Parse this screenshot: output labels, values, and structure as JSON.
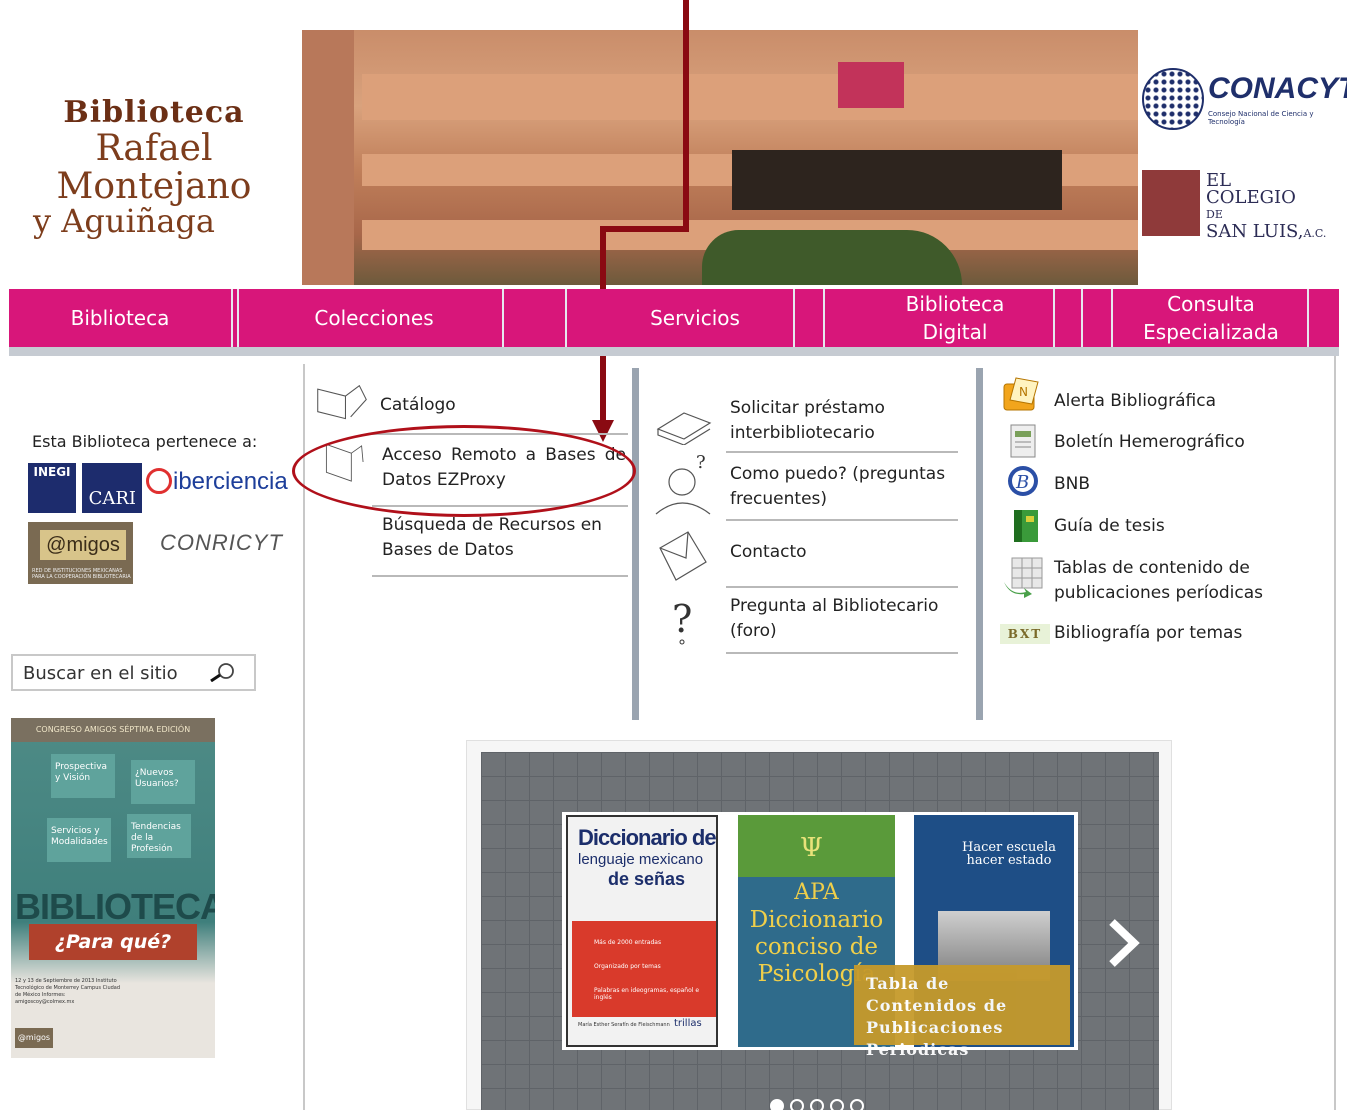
{
  "header": {
    "library_name_line1": "Biblioteca",
    "library_name_line2": "Rafael Montejano",
    "library_name_line3": "y Aguiñaga",
    "conacyt": {
      "name": "CONACYT",
      "subtitle": "Consejo Nacional de Ciencia y Tecnología"
    },
    "colegio": {
      "line1": "EL",
      "line2": "COLEGIO",
      "line3": "DE",
      "line4": "SAN LUIS,",
      "suffix": "A.C."
    },
    "banner_sign": "BIBLIOTECA"
  },
  "nav": {
    "items": [
      {
        "label": "Biblioteca"
      },
      {
        "label": "Colecciones"
      },
      {
        "label": "Servicios"
      },
      {
        "label": "Biblioteca Digital"
      },
      {
        "label": "Consulta Especializada"
      }
    ]
  },
  "sidebar": {
    "pertenece": "Esta Biblioteca pertenece a:",
    "logos": {
      "inegi": "INEGI",
      "cari": "CARI",
      "ciberciencia": "iberciencia",
      "amigos": "@migos",
      "amigos_sub": "RED DE INSTITUCIONES MEXICANAS PARA LA COOPERACIÓN BIBLIOTECARIA",
      "conricyt": "CONRICYT"
    },
    "search_label": "Buscar en el sitio",
    "poster": {
      "top": "CONGRESO AMIGOS   SÉPTIMA EDICIÓN",
      "sign1": "Prospectiva y Visión",
      "sign2": "¿Nuevos Usuarios?",
      "sign3": "Servicios y Modalidades",
      "sign4": "Tendencias de la Profesión",
      "title": "BIBLIOTECAS",
      "subtitle": "¿Para qué?",
      "footer": "12 y 13 de Septiembre de 2013 Instituto Tecnológico de Monterrey Campus Ciudad de México Informes: amigoscoy@colmex.mx",
      "footer_logo": "@migos"
    }
  },
  "colecciones": {
    "items": [
      {
        "label": "Catálogo"
      },
      {
        "label": "Acceso Remoto a Bases de Datos EZProxy"
      },
      {
        "label": "Búsqueda de Recursos en Bases de Datos"
      }
    ]
  },
  "servicios": {
    "items": [
      {
        "label": "Solicitar préstamo interbibliotecario"
      },
      {
        "label": "Como puedo? (preguntas frecuentes)"
      },
      {
        "label": "Contacto"
      },
      {
        "label": "Pregunta al Bibliotecario (foro)"
      }
    ]
  },
  "digital": {
    "items": [
      {
        "label": "Alerta Bibliográfica",
        "icon": "alert-icon"
      },
      {
        "label": "Boletín Hemerográfico",
        "icon": "newsletter-icon"
      },
      {
        "label": "BNB",
        "icon": "bnb-icon"
      },
      {
        "label": "Guía de tesis",
        "icon": "thesis-icon"
      },
      {
        "label": "Tablas de contenido de publicaciones períodicas",
        "icon": "table-icon"
      },
      {
        "label": "Bibliografía por temas",
        "icon": "bxt-icon",
        "badge": "BXT"
      }
    ]
  },
  "carousel": {
    "book1": {
      "title_a": "Diccionario de",
      "title_b": "lenguaje mexicano",
      "title_c": "de señas",
      "bullets": [
        "Más de 2000 entradas",
        "Organizado por temas",
        "Palabras en ideogramas, español e inglés"
      ],
      "author": "María Esther Serafín de Fleischmann",
      "publisher": "trillas"
    },
    "book2": {
      "psi": "Ψ",
      "apa": "APA",
      "title": "Diccionario conciso de Psicología"
    },
    "book3": {
      "title": "Hacer escuela hacer estado"
    },
    "caption": "Tabla de Contenidos de Publicaciones Periodicas",
    "dots": 5
  },
  "colors": {
    "nav": "#d8167a",
    "annotation": "#8a0a12",
    "caption": "#c69a2b"
  }
}
